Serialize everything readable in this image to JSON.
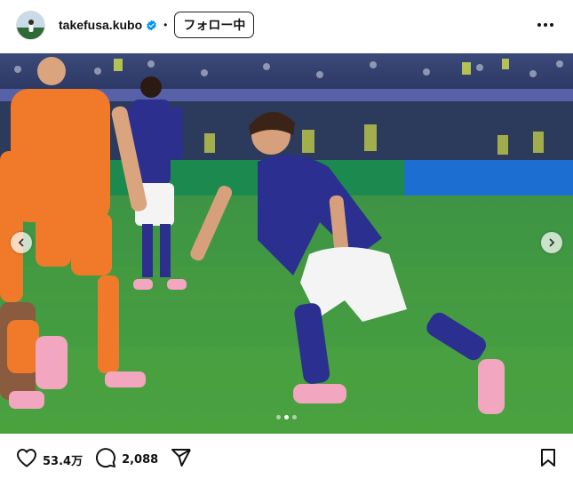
{
  "header": {
    "username": "takefusa.kubo",
    "separator": "•",
    "follow_label": "フォロー中"
  },
  "post": {
    "image_count": 3,
    "active_index": 2
  },
  "actions": {
    "likes": "53.4万",
    "comments": "2,088"
  },
  "colors": {
    "verified": "#0095f6",
    "pitch": "#3f9a3c",
    "japan_blue": "#2b2f8f",
    "netherlands_orange": "#f07a2a"
  },
  "icons": {
    "like": "heart-icon",
    "comment": "comment-icon",
    "share": "send-icon",
    "save": "bookmark-icon",
    "more": "more-dots-icon",
    "prev": "chevron-left-icon",
    "next": "chevron-right-icon"
  }
}
